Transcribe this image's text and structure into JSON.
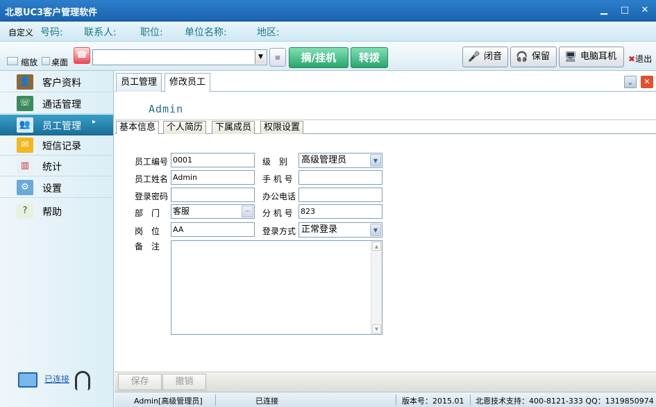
{
  "title": "北恩UC3客户管理软件",
  "window": {
    "minimize": "▁",
    "maximize": "□",
    "close": "✕"
  },
  "info": {
    "custom": "自定义",
    "fields": [
      "号码:",
      "联系人:",
      "职位:",
      "单位名称:",
      "地区:"
    ]
  },
  "toolbar": {
    "shrink": "缩放",
    "desktop": "桌面",
    "pickup_hangup": "摘/挂机",
    "transfer": "转拨",
    "mute": "闭音",
    "hold": "保留",
    "pc_headset": "电脑耳机",
    "exit": "退出"
  },
  "sidebar": {
    "items": [
      {
        "label": "客户资料",
        "icon": "customer-icon"
      },
      {
        "label": "通话管理",
        "icon": "call-icon"
      },
      {
        "label": "员工管理",
        "icon": "staff-icon",
        "active": true
      },
      {
        "label": "短信记录",
        "icon": "mail-icon"
      },
      {
        "label": "统计",
        "icon": "chart-icon"
      },
      {
        "label": "设置",
        "icon": "settings-icon"
      },
      {
        "label": "帮助",
        "icon": "help-icon"
      }
    ],
    "connection": "已连接"
  },
  "tabs": [
    "员工管理",
    "修改员工"
  ],
  "header_user": "Admin",
  "subtabs": [
    "基本信息",
    "个人简历",
    "下属成员",
    "权限设置"
  ],
  "form": {
    "emp_no_label": "员工编号",
    "emp_no": "0001",
    "level_label": "级　别",
    "level": "高级管理员",
    "name_label": "员工姓名",
    "name": "Admin",
    "mobile_label": "手 机 号",
    "mobile": "",
    "password_label": "登录密码",
    "password": "",
    "office_phone_label": "办公电话",
    "office_phone": "",
    "dept_label": "部　门",
    "dept": "客服",
    "ext_label": "分 机 号",
    "ext": "823",
    "post_label": "岗　位",
    "post": "AA",
    "login_mode_label": "登录方式",
    "login_mode": "正常登录",
    "remark_label": "备　注",
    "remark": ""
  },
  "buttons": {
    "save": "保存",
    "undo": "撤销"
  },
  "status": {
    "user": "Admin[高级管理员]",
    "conn": "已连接",
    "version": "版本号：2015.01",
    "support": "北恩技术支持：400-8121-333 QQ：1319850974"
  },
  "colors": {
    "accent": "#1a6f99",
    "titlebar": "#1a63b0",
    "green": "#2aa56d"
  }
}
